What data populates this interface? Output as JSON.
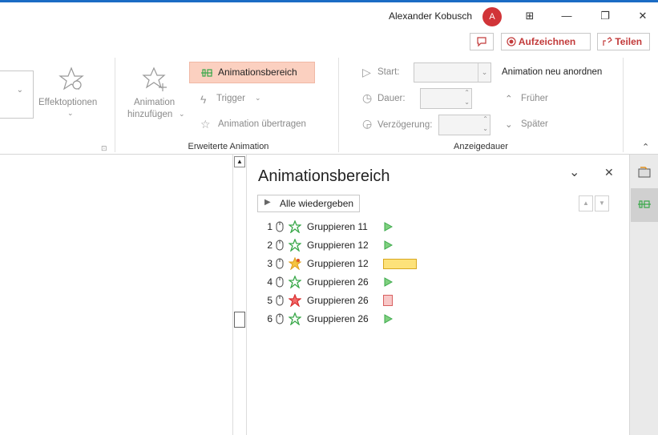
{
  "titlebar": {
    "user_name": "Alexander Kobusch",
    "avatar_initial": "A",
    "min_symbol": "—",
    "restore_symbol": "❐",
    "close_symbol": "✕",
    "ribbon_opts_symbol": "⊞"
  },
  "ribbon": {
    "record_label": "Aufzeichnen",
    "share_label": "Teilen",
    "effect_options_label": "Effektoptionen",
    "add_animation_label_1": "Animation",
    "add_animation_label_2": "hinzufügen",
    "animation_pane_label": "Animationsbereich",
    "trigger_label": "Trigger",
    "animation_painter_label": "Animation übertragen",
    "group_advanced_label": "Erweiterte Animation",
    "start_label": "Start:",
    "duration_label": "Dauer:",
    "delay_label": "Verzögerung:",
    "reorder_label": "Animation neu anordnen",
    "earlier_label": "Früher",
    "later_label": "Später",
    "group_timing_label": "Anzeigedauer"
  },
  "anim_pane": {
    "title": "Animationsbereich",
    "play_all_label": "Alle wiedergeben",
    "items": [
      {
        "num": "1",
        "label": "Gruppieren 11",
        "effect": "entrance",
        "bar": "play"
      },
      {
        "num": "2",
        "label": "Gruppieren 12",
        "effect": "entrance",
        "bar": "play"
      },
      {
        "num": "3",
        "label": "Gruppieren 12",
        "effect": "emphasis",
        "bar": "yellow-bar"
      },
      {
        "num": "4",
        "label": "Gruppieren 26",
        "effect": "entrance",
        "bar": "play"
      },
      {
        "num": "5",
        "label": "Gruppieren 26",
        "effect": "exit",
        "bar": "red-box"
      },
      {
        "num": "6",
        "label": "Gruppieren 26",
        "effect": "entrance",
        "bar": "play"
      }
    ]
  },
  "colors": {
    "accent": "#c23a3a",
    "highlight": "#fbd0c0",
    "entrance": "#3aa84a",
    "emphasis": "#e0a020",
    "exit": "#d83030",
    "window_border": "#1e6fc8"
  }
}
